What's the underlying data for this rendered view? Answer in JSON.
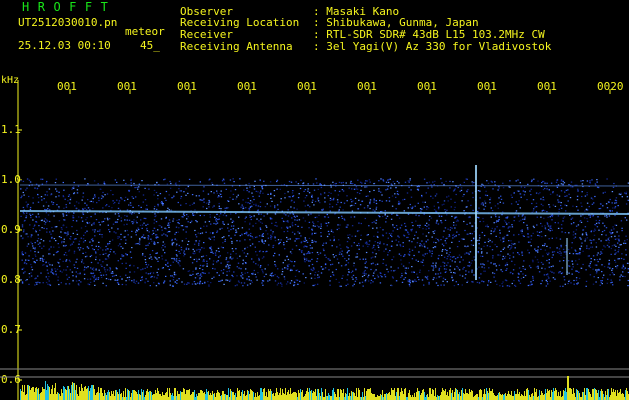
{
  "header": {
    "brand": "HROFFT",
    "filename": "UT2512030010.pn",
    "type_label": "meteor",
    "datetime": "25.12.03 00:10",
    "count": "45_"
  },
  "meta": [
    {
      "key": "Observer",
      "value": ": Masaki Kano"
    },
    {
      "key": "Receiving Location",
      "value": ": Shibukawa, Gunma, Japan"
    },
    {
      "key": "Receiver",
      "value": ": RTL-SDR SDR# 43dB L15 103.2MHz CW"
    },
    {
      "key": "Receiving Antenna",
      "value": ": 3el Yagi(V) Az 330 for Vladivostok"
    }
  ],
  "axis": {
    "y_unit": "kHz",
    "y_ticks": [
      "1.1",
      "1.0",
      "0.9",
      "0.8",
      "0.7",
      "0.6"
    ],
    "x_ticks": [
      "001",
      "001",
      "001",
      "001",
      "001",
      "001",
      "001",
      "001",
      "001",
      "0020"
    ]
  },
  "colors": {
    "text": "#f5f51e",
    "brand": "#19e619",
    "noise_dark": "#0a1a6e",
    "noise_light": "#3c6cff",
    "line": "#80c8ff",
    "bars": "#e0e020"
  }
}
